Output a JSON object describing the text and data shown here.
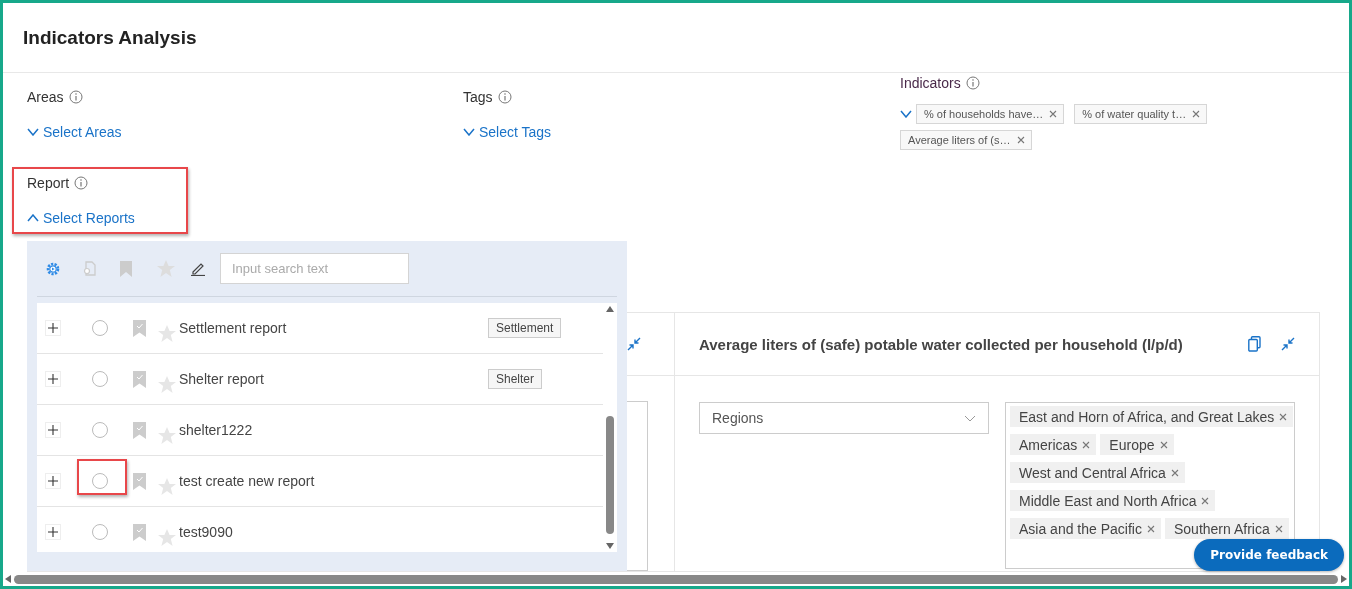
{
  "header": {
    "title": "Indicators Analysis"
  },
  "filters": [
    {
      "kind": "dropdown",
      "label": "Areas",
      "link": "Select Areas",
      "expanded": false,
      "highlighted": false
    },
    {
      "kind": "dropdown",
      "label": "Tags",
      "link": "Select Tags",
      "expanded": false,
      "highlighted": false
    },
    {
      "kind": "chips",
      "label": "Indicators",
      "expanded": false,
      "highlighted": false,
      "chips": [
        "% of households have…",
        "% of water quality t…",
        "Average liters of (s…"
      ]
    },
    {
      "kind": "dropdown",
      "label": "Report",
      "link": "Select Reports",
      "expanded": true,
      "highlighted": true
    }
  ],
  "report_panel": {
    "search": {
      "placeholder": "Input search text"
    },
    "rows": [
      {
        "name": "Settlement report",
        "tag": "Settlement",
        "selected": false,
        "highlighted": false
      },
      {
        "name": "Shelter report",
        "tag": "Shelter",
        "selected": false,
        "highlighted": false
      },
      {
        "name": "shelter1222",
        "selected": false,
        "highlighted": false
      },
      {
        "name": "test create new report",
        "selected": false,
        "highlighted": true
      },
      {
        "name": "test9090",
        "selected": false,
        "highlighted": false
      }
    ]
  },
  "chart_card": {
    "title": "Average liters of (safe) potable water collected per household (l/p/d)",
    "breakdown": {
      "value": "Regions"
    },
    "region_tags": [
      "East and Horn of Africa, and Great Lakes",
      "Americas",
      "Europe",
      "West and Central Africa",
      "Middle East and North Africa",
      "Asia and the Pacific",
      "Southern Africa"
    ]
  },
  "feedback_button": "Provide feedback"
}
